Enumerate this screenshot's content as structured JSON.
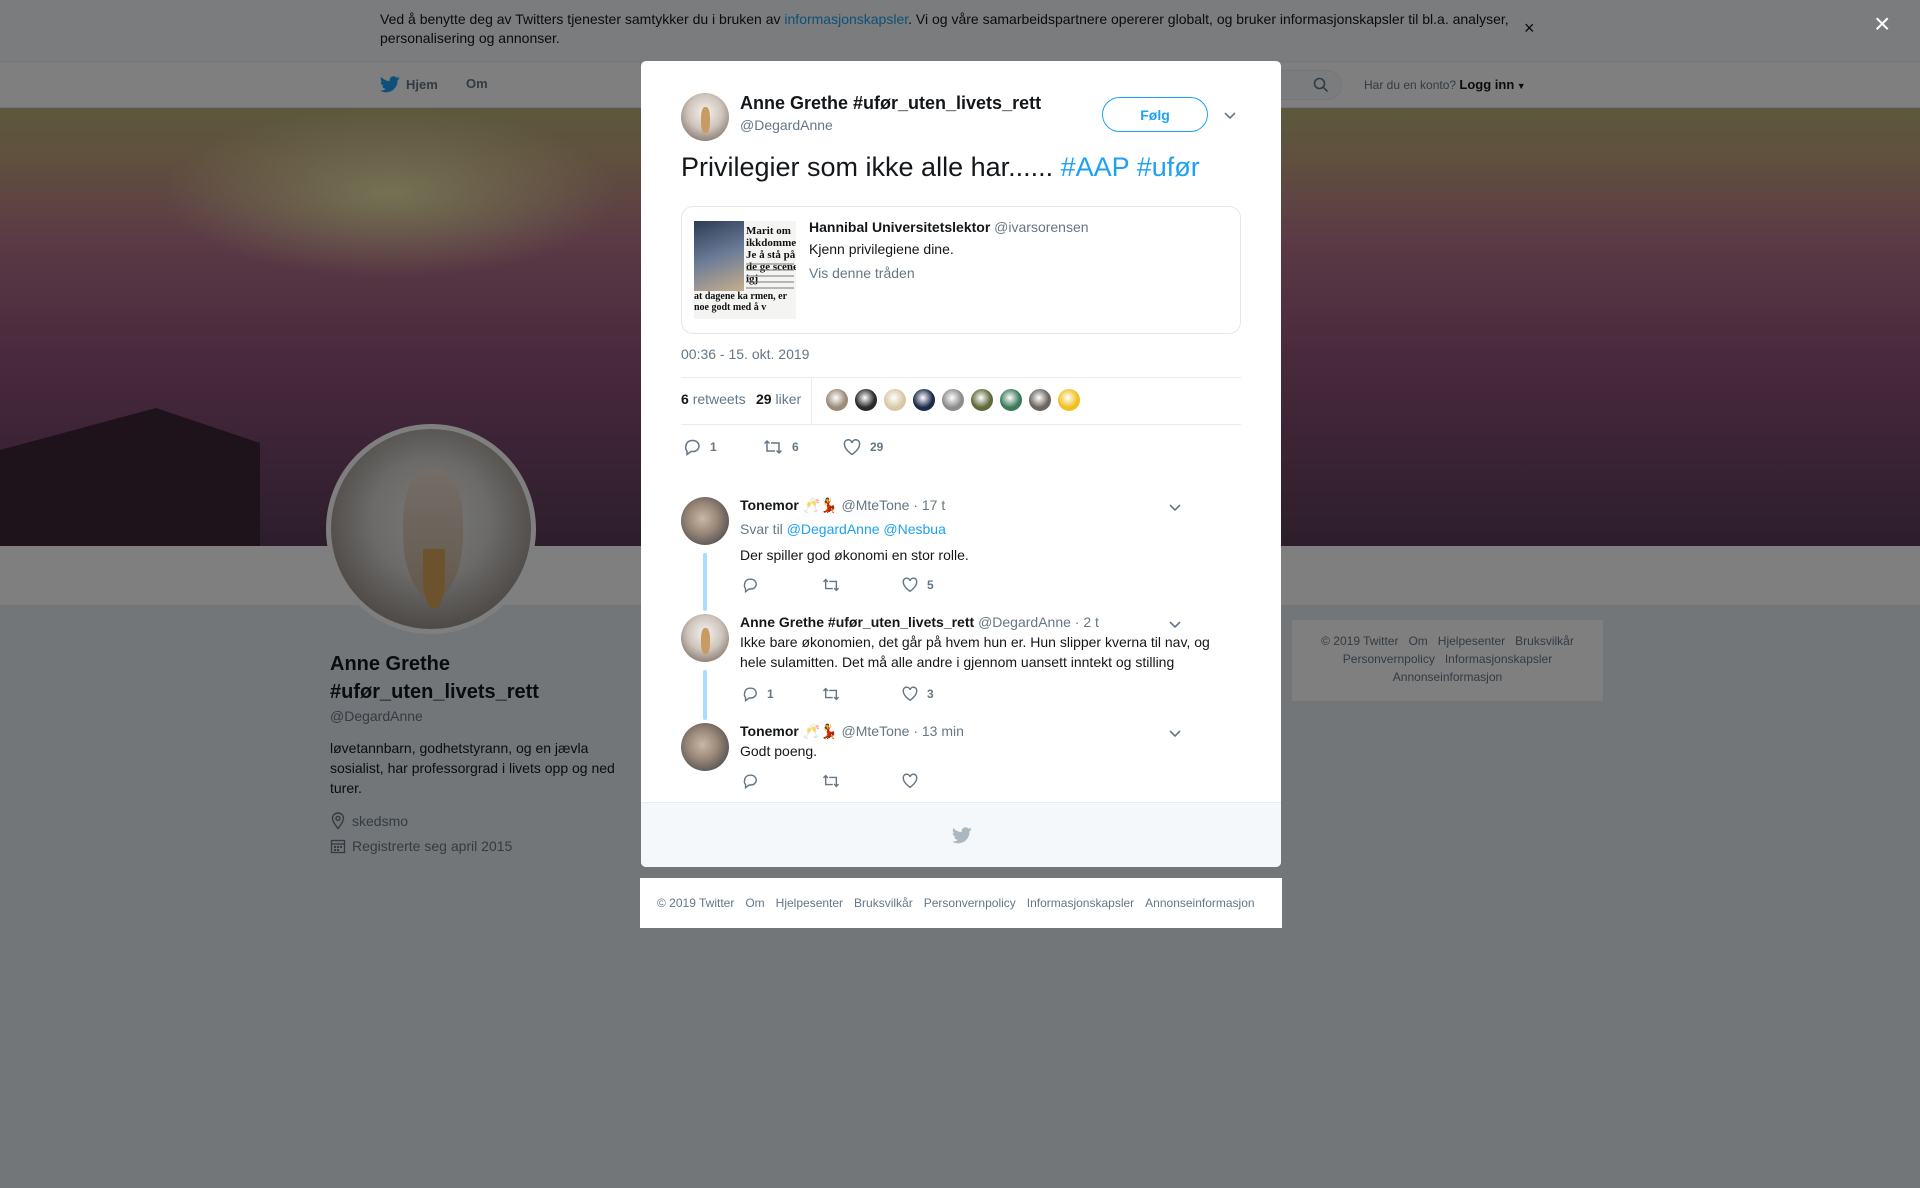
{
  "cookie_banner": {
    "text_before": "Ved å benytte deg av Twitters tjenester samtykker du i bruken av ",
    "link": "informasjonskapsler",
    "text_after": ". Vi og våre samarbeidspartnere opererer globalt, og bruker informasjonskapsler til bl.a. analyser, personalisering og annonser.",
    "close": "×"
  },
  "nav": {
    "home": "Hjem",
    "about": "Om",
    "login_prompt": "Har du en konto?",
    "login": "Logg inn"
  },
  "profile": {
    "name": "Anne Grethe #ufør_uten_livets_rett",
    "handle": "@DegardAnne",
    "bio": "løvetannbarn, godhetstyrann, og en jævla sosialist, har professorgrad i livets opp og ned turer.",
    "location": "skedsmo",
    "joined": "Registrerte seg april 2015"
  },
  "side_footer": {
    "links": [
      "© 2019 Twitter",
      "Om",
      "Hjelpesenter",
      "Bruksvilkår",
      "Personvernpolicy",
      "Informasjonskapsler",
      "Annonseinformasjon"
    ]
  },
  "overlay_close": "×",
  "tweet": {
    "author_name": "Anne Grethe #ufør_uten_livets_rett",
    "author_handle": "@DegardAnne",
    "follow_label": "Følg",
    "text": "Privilegier som ikke alle har...... ",
    "hashtags": [
      "#AAP",
      "#ufør"
    ],
    "quoted": {
      "name": "Hannibal Universitetslektor",
      "handle": "@ivarsorensen",
      "text": "Kjenn privilegiene dine.",
      "link": "Vis denne tråden",
      "thumb_headline": "Marit om ikkdommen: Je å stå på de ge scenen igj",
      "thumb_caption": "at dagene ka rmen, er noe godt med å v"
    },
    "timestamp": "00:36 - 15. okt. 2019",
    "retweets_count": "6",
    "retweets_label": "retweets",
    "likes_count": "29",
    "likes_label": "liker",
    "liker_colors": [
      "#9a8a78",
      "#2a2a2a",
      "#d8c9a6",
      "#1c2b4a",
      "#8c8c8c",
      "#5f6a3a",
      "#3d7a5a",
      "#6b6560",
      "#f0c020"
    ],
    "actions": {
      "replies": "1",
      "retweets": "6",
      "likes": "29"
    }
  },
  "replies": [
    {
      "name": "Tonemor",
      "emoji": "🥂💃",
      "handle": "@MteTone",
      "time": "· 17 t",
      "reply_to_prefix": "Svar til",
      "reply_to": "@DegardAnne @Nesbua",
      "text": "Der spiller god økonomi en stor rolle.",
      "reply_count": "",
      "retweet_count": "",
      "like_count": "5"
    },
    {
      "name": "Anne Grethe #ufør_uten_livets_rett",
      "emoji": "",
      "handle": "@DegardAnne",
      "time": "· 2 t",
      "text": "Ikke bare økonomien, det går på hvem hun er. Hun slipper kverna til nav, og hele sulamitten. Det må alle andre i gjennom uansett inntekt og stilling",
      "reply_count": "1",
      "retweet_count": "",
      "like_count": "3"
    },
    {
      "name": "Tonemor",
      "emoji": "🥂💃",
      "handle": "@MteTone",
      "time": "· 13 min",
      "text": "Godt poeng.",
      "reply_count": "",
      "retweet_count": "",
      "like_count": ""
    }
  ],
  "bottom_footer": {
    "links": [
      "© 2019 Twitter",
      "Om",
      "Hjelpesenter",
      "Bruksvilkår",
      "Personvernpolicy",
      "Informasjonskapsler",
      "Annonseinformasjon"
    ]
  },
  "colors": {
    "accent": "#1da1f2",
    "muted": "#657786",
    "thread_line": "#aadcff"
  }
}
